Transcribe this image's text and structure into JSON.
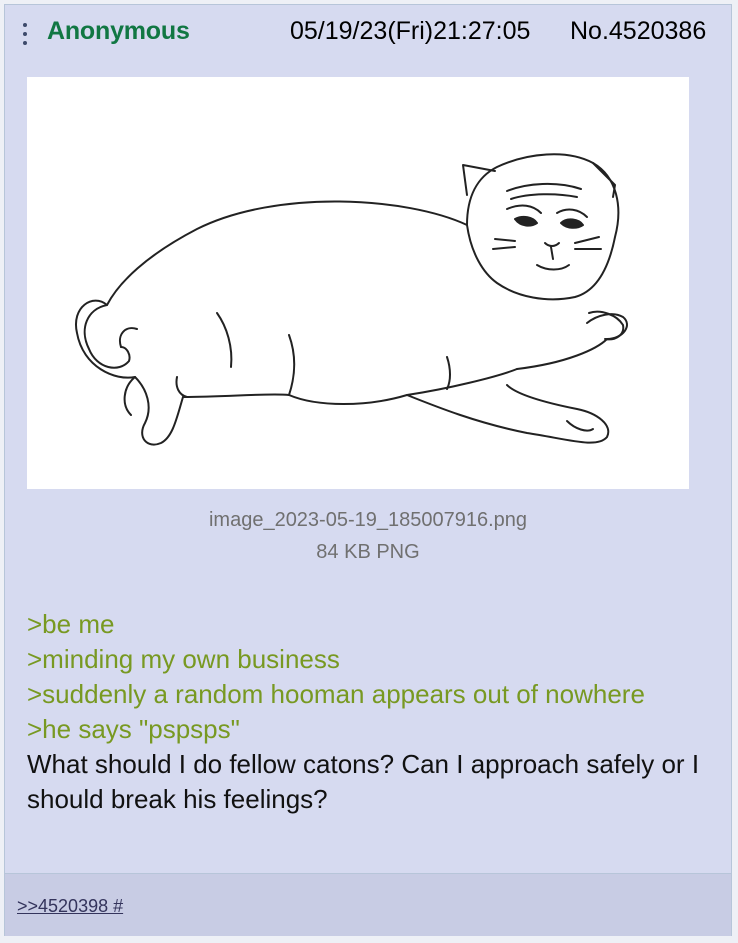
{
  "post": {
    "name": "Anonymous",
    "datetime": "05/19/23(Fri)21:27:05",
    "number": "No.4520386",
    "file": {
      "filename": "image_2023-05-19_185007916.png",
      "size": "84 KB PNG"
    },
    "greentext": [
      ">be me",
      ">minding my own business",
      ">suddenly a random hooman appears out of nowhere",
      ">he says \"pspsps\""
    ],
    "body_text": "What should I do fellow catons? Can I approach safely or I should break his feelings?",
    "backlink": ">>4520398 #"
  },
  "icons": {
    "menu": "vertical-ellipsis-icon"
  },
  "colors": {
    "post_bg": "#d6daf0",
    "name": "#117743",
    "greentext": "#789922",
    "backlink": "#34345c"
  }
}
